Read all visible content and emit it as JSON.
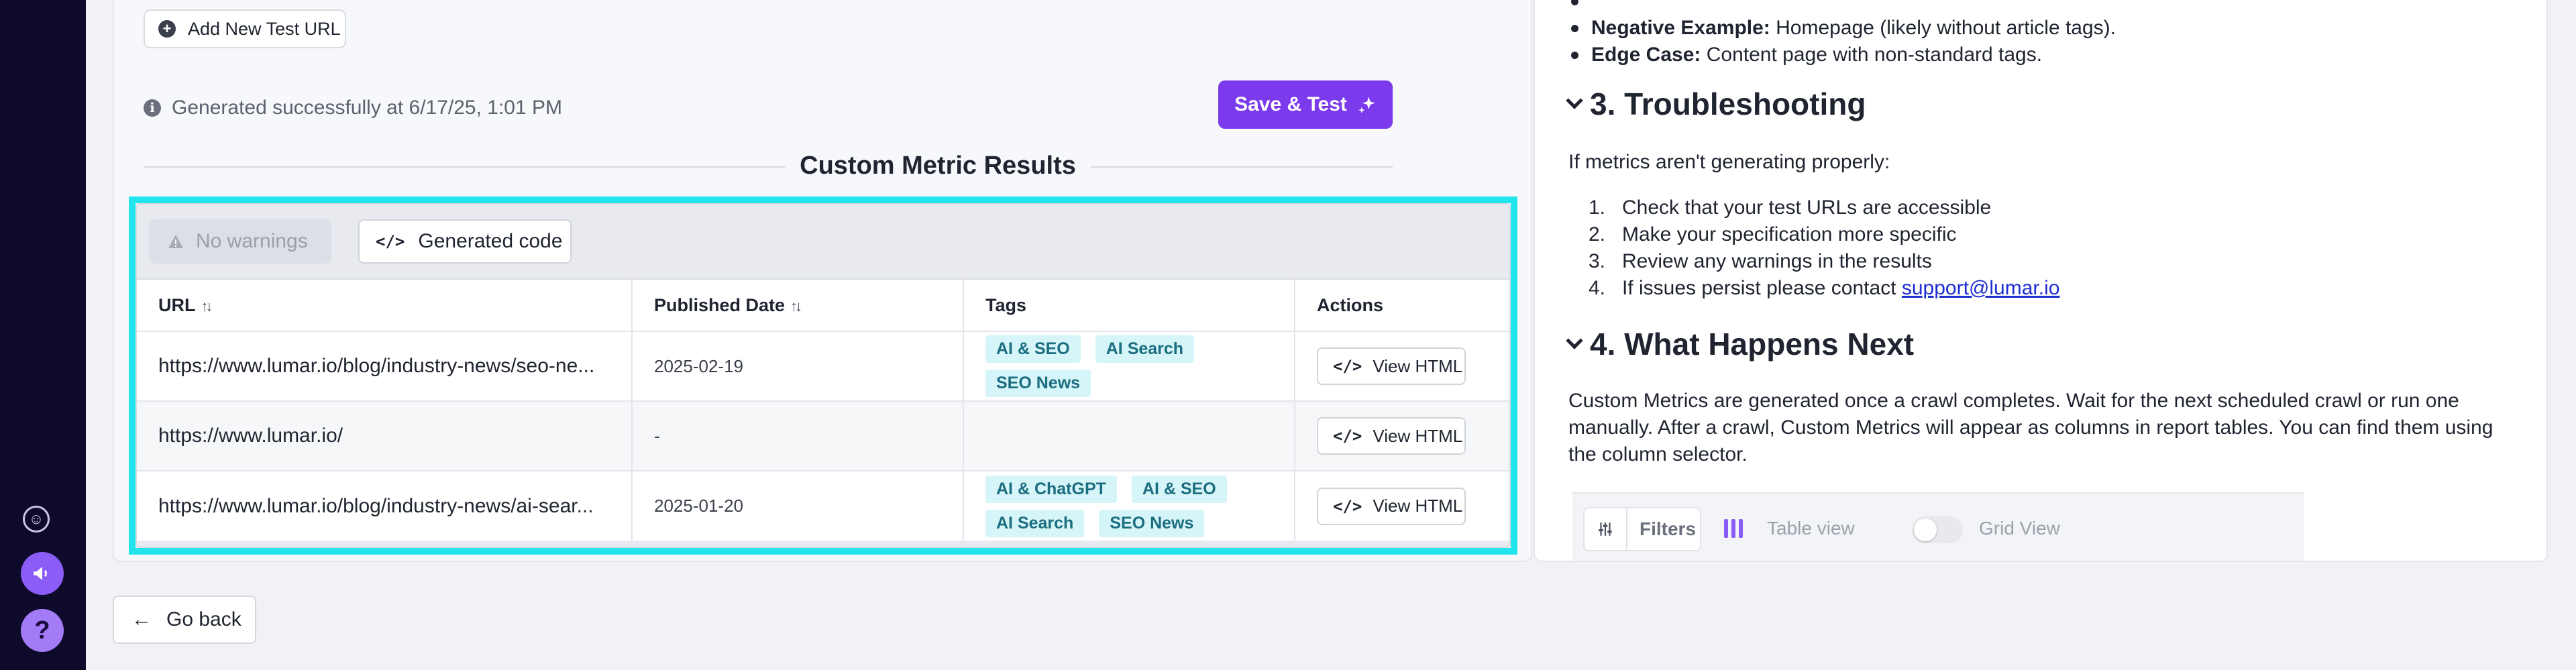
{
  "main": {
    "add_url_label": "Add New Test URL",
    "status_text": "Generated successfully at 6/17/25, 1:01 PM",
    "save_test_label": "Save & Test",
    "section_title": "Custom Metric Results",
    "results": {
      "no_warnings_label": "No warnings",
      "generated_code_label": "Generated code",
      "columns": [
        "URL",
        "Published Date",
        "Tags",
        "Actions"
      ],
      "rows": [
        {
          "url": "https://www.lumar.io/blog/industry-news/seo-ne...",
          "date": "2025-02-19",
          "tags": [
            "AI & SEO",
            "AI Search",
            "SEO News"
          ],
          "action": "View HTML"
        },
        {
          "url": "https://www.lumar.io/",
          "date": "-",
          "tags": [],
          "action": "View HTML"
        },
        {
          "url": "https://www.lumar.io/blog/industry-news/ai-sear...",
          "date": "2025-01-20",
          "tags": [
            "AI & ChatGPT",
            "AI & SEO",
            "AI Search",
            "SEO News"
          ],
          "action": "View HTML"
        }
      ]
    }
  },
  "go_back_label": "Go back",
  "doc": {
    "bullets": [
      {
        "bold": "Negative Example:",
        "text": " Homepage (likely without article tags)."
      },
      {
        "bold": "Edge Case:",
        "text": " Content page with non-standard tags."
      }
    ],
    "troubleshooting_title": "3. Troubleshooting",
    "troubleshooting_intro": "If metrics aren't generating properly:",
    "steps": [
      "Check that your test URLs are accessible",
      "Make your specification more specific",
      "Review any warnings in the results",
      "If issues persist please contact "
    ],
    "support_link": "support@lumar.io",
    "next_title": "4. What Happens Next",
    "next_text": "Custom Metrics are generated once a crawl completes. Wait for the next scheduled crawl or run one manually. After a crawl, Custom Metrics will appear as columns in report tables. You can find them using the column selector.",
    "filter_strip": {
      "filters_label": "Filters",
      "table_view_label": "Table view",
      "grid_view_label": "Grid View"
    }
  },
  "colors": {
    "accent": "#7c3aed",
    "highlight": "#22e4ec",
    "tag_bg": "#d6f5f8",
    "tag_text": "#1b6d80",
    "rail": "#0d0a2b"
  }
}
